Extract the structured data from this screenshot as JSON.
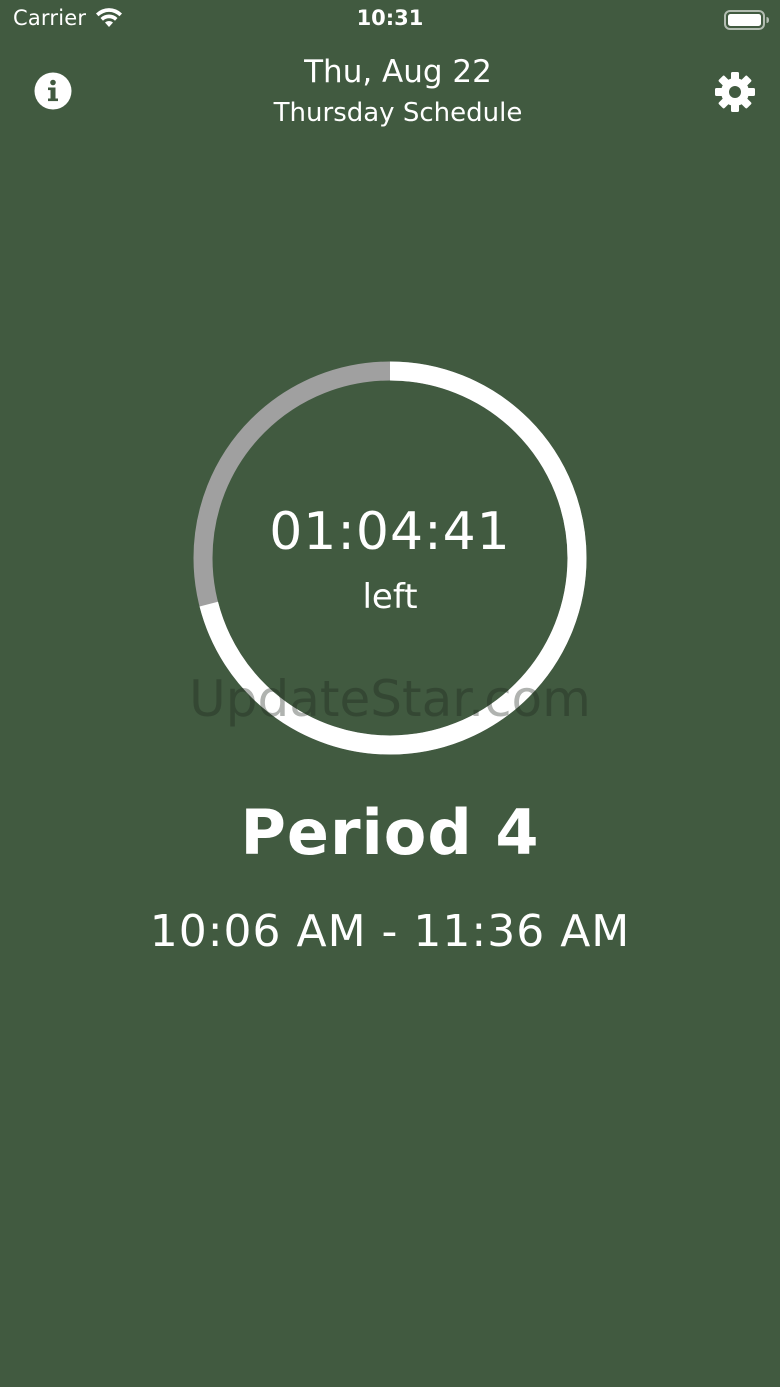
{
  "status_bar": {
    "carrier": "Carrier",
    "time": "10:31",
    "icons": [
      "wifi-icon",
      "battery-icon"
    ]
  },
  "header": {
    "date": "Thu, Aug 22",
    "schedule": "Thursday Schedule",
    "left_icon": "info-icon",
    "right_icon": "gear-icon"
  },
  "countdown": {
    "time_left": "01:04:41",
    "label": "left",
    "progress_elapsed_fraction": 0.29
  },
  "period": {
    "name": "Period 4",
    "time_range": "10:06 AM - 11:36 AM"
  },
  "watermark": "UpdateStar.com",
  "colors": {
    "background": "#415a40",
    "ring_remaining": "#ffffff",
    "ring_elapsed": "#a0a0a0",
    "text": "#ffffff"
  }
}
